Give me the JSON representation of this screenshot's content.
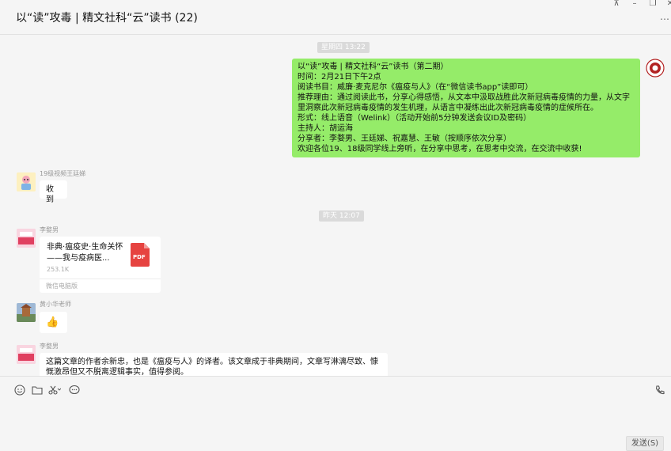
{
  "window": {
    "title": "以“读”攻毒 | 精文社科“云”读书 (22)",
    "controls": {
      "pin": "⊼",
      "minimize": "–",
      "maximize": "❐",
      "close": "✕"
    },
    "more": "…"
  },
  "messages": {
    "time1": "星期四 13:22",
    "mine": {
      "lines": [
        "以“读”攻毒 | 精文社科“云”读书（第二期）",
        "时间：2月21日下午2点",
        "阅读书目：威廉·麦克尼尔《瘟疫与人》（在“微信读书app”读即可）",
        "推荐理由：通过阅读此书，分享心得感悟，从文本中汲取战胜此次新冠病毒疫情的力量，从文字",
        "里洞察此次新冠病毒疫情的发生机理，从语言中凝练出此次新冠病毒疫情的症候所在。",
        "形式：线上语音（Welink）（活动开始前5分钟发送会议ID及密码）",
        "主持人：胡运海",
        "分享者：李婺男、王廷娣、祝嘉慧、王敏（按顺序依次分享）",
        "欢迎各位19、18级同学线上旁听，在分享中思考，在思考中交流，在交流中收获!"
      ]
    },
    "msg2": {
      "sender": "19级视频王廷娣",
      "text": "收到"
    },
    "time2": "昨天 12:07",
    "msg3": {
      "sender": "李婺男",
      "file_name": "非典·瘟疫史·生命关怀——我与疫病医...",
      "file_size": "253.1K",
      "file_source": "微信电脑版",
      "file_type": "PDF"
    },
    "msg4": {
      "sender": "黄小华老师",
      "emoji": "👍"
    },
    "msg5": {
      "sender": "李婺男",
      "lines": [
        "这篇文章的作者余新忠，也是《瘟疫与人》的译者。该文章成于非典期间，文章写淋漓尽致、慷",
        "慨激昂但又不脱离逻辑事实，值得参阅。"
      ]
    }
  },
  "input": {
    "tools": [
      "emoji-icon",
      "folder-icon",
      "scissors-icon",
      "chat-history-icon"
    ],
    "send_label": "发送(S)",
    "call_icon": "phone-icon"
  },
  "colors": {
    "my_bubble": "#95ec69",
    "pdf_red": "#e64340"
  }
}
